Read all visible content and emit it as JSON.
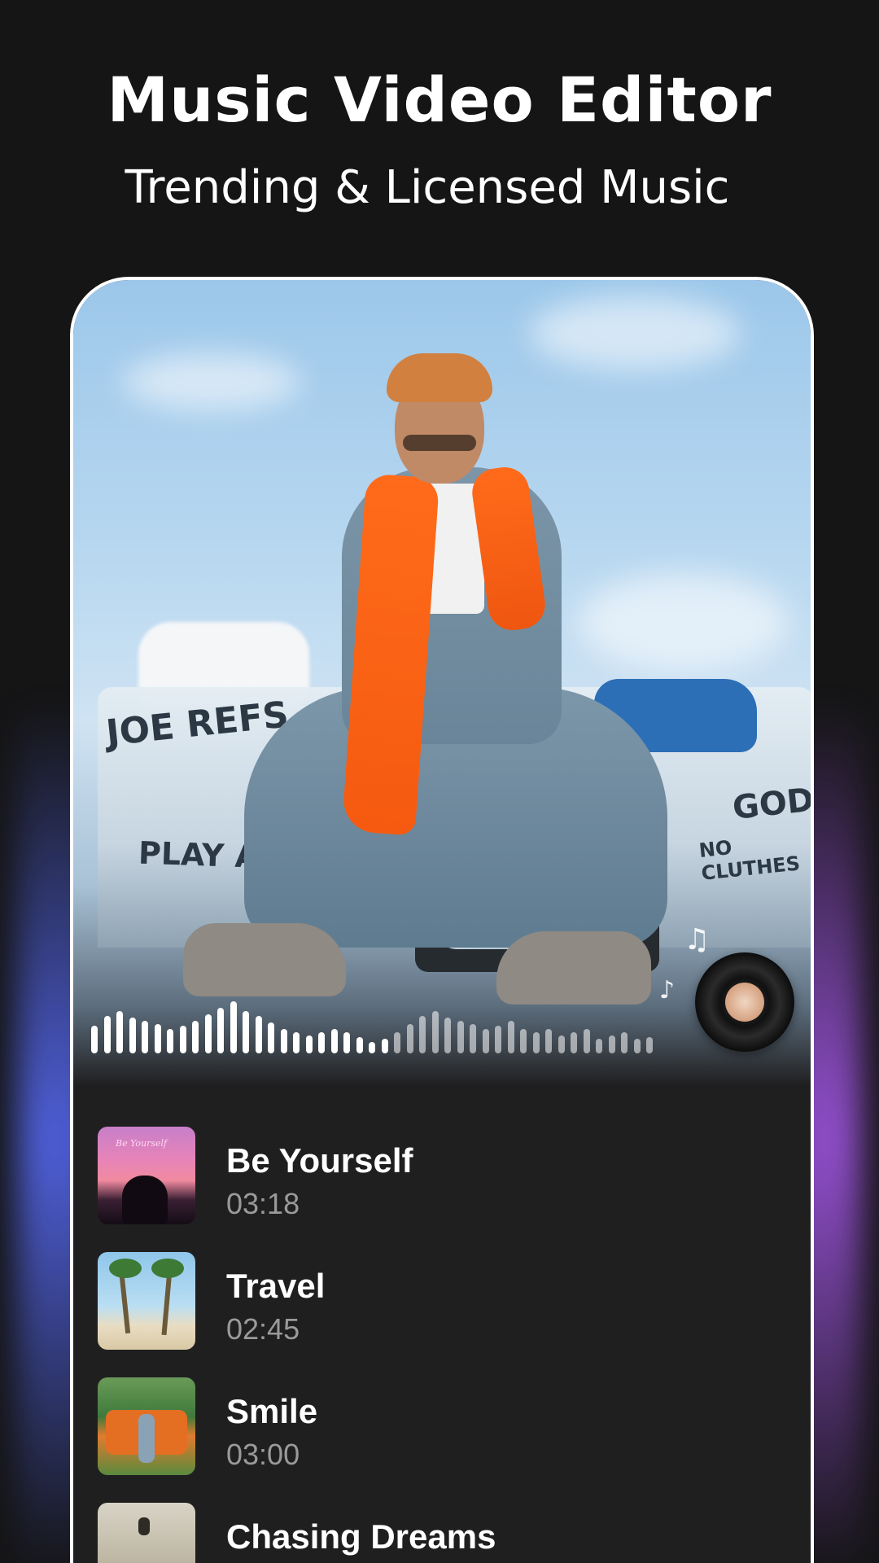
{
  "header": {
    "title": "Music Video Editor",
    "subtitle": "Trending & Licensed Music"
  },
  "hero": {
    "graffiti_1": "JOE REFS",
    "graffiti_2": "PLAY ALL",
    "graffiti_3": "NO",
    "graffiti_4": "GOD.",
    "graffiti_5": "NO CLUTHES",
    "note_icon_a": "♫",
    "note_icon_b": "♪"
  },
  "colors": {
    "background": "#151516",
    "panel": "#1f1f20",
    "title": "#ffffff",
    "duration": "#9a9a9a",
    "glow_left": "#5a6eff",
    "glow_right": "#aa5af0"
  },
  "tracks": [
    {
      "title": "Be Yourself",
      "duration": "03:18",
      "thumb_label": "Be Yourself"
    },
    {
      "title": "Travel",
      "duration": "02:45"
    },
    {
      "title": "Smile",
      "duration": "03:00"
    },
    {
      "title": "Chasing Dreams",
      "duration": ""
    }
  ]
}
